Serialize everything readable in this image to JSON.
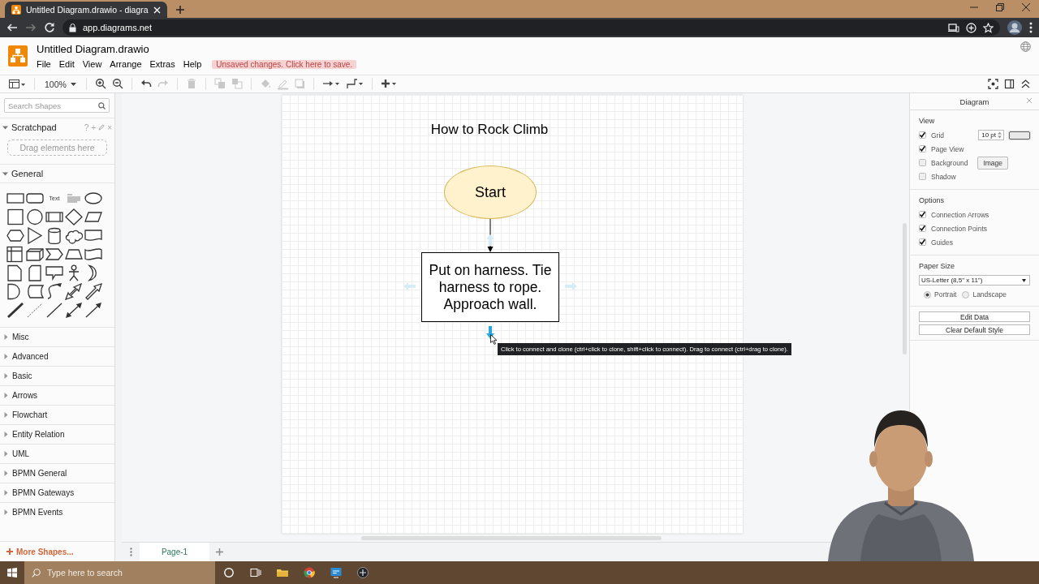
{
  "browser": {
    "tab_title": "Untitled Diagram.drawio - diagra",
    "url": "app.diagrams.net",
    "nav": [
      {
        "kind": "back",
        "disabled": false
      },
      {
        "kind": "forward",
        "disabled": true
      },
      {
        "kind": "reload",
        "disabled": false
      }
    ]
  },
  "app": {
    "file_name": "Untitled Diagram.drawio",
    "menus": [
      "File",
      "Edit",
      "View",
      "Arrange",
      "Extras",
      "Help"
    ],
    "save_notice": "Unsaved changes. Click here to save."
  },
  "toolbar": {
    "zoom": "100%",
    "tools": [
      {
        "kind": "panel",
        "disabled": false
      },
      {
        "kind": "zoomin",
        "disabled": false
      },
      {
        "kind": "zoomout",
        "disabled": false
      },
      {
        "kind": "undo",
        "disabled": false
      },
      {
        "kind": "redo",
        "disabled": true
      },
      {
        "kind": "delete",
        "disabled": true
      },
      {
        "kind": "tofront",
        "disabled": true
      },
      {
        "kind": "toback",
        "disabled": true
      },
      {
        "kind": "fill",
        "disabled": true
      },
      {
        "kind": "linecolor",
        "disabled": true
      },
      {
        "kind": "shadow",
        "disabled": true
      },
      {
        "kind": "connection",
        "disabled": false
      },
      {
        "kind": "waypoints",
        "disabled": false
      },
      {
        "kind": "insert",
        "disabled": false
      }
    ],
    "right_tools": [
      {
        "kind": "fullscreen"
      },
      {
        "kind": "format"
      },
      {
        "kind": "collapse"
      }
    ]
  },
  "sidebar": {
    "search": {
      "placeholder": "Search Shapes"
    },
    "scratchpad": {
      "title": "Scratchpad",
      "expanded": true,
      "actions": [
        "?",
        "+",
        "×"
      ],
      "drop_hint": "Drag elements here"
    },
    "general": {
      "title": "General",
      "expanded": true,
      "shapes": [
        {
          "kind": "rectangle"
        },
        {
          "kind": "rounded"
        },
        {
          "kind": "text",
          "label": "Text"
        },
        {
          "kind": "textbox"
        },
        {
          "kind": "ellipse"
        },
        {
          "kind": "square"
        },
        {
          "kind": "circle"
        },
        {
          "kind": "process"
        },
        {
          "kind": "diamond"
        },
        {
          "kind": "parallelogram"
        },
        {
          "kind": "hexagon"
        },
        {
          "kind": "triangle"
        },
        {
          "kind": "cylinder"
        },
        {
          "kind": "cloud"
        },
        {
          "kind": "document"
        },
        {
          "kind": "storage"
        },
        {
          "kind": "cube"
        },
        {
          "kind": "step"
        },
        {
          "kind": "trapezoid"
        },
        {
          "kind": "tape"
        },
        {
          "kind": "note"
        },
        {
          "kind": "card"
        },
        {
          "kind": "callout"
        },
        {
          "kind": "actor"
        },
        {
          "kind": "or"
        },
        {
          "kind": "and"
        },
        {
          "kind": "datastore"
        },
        {
          "kind": "curve"
        },
        {
          "kind": "doublearrow"
        },
        {
          "kind": "arrow"
        },
        {
          "kind": "thickline"
        },
        {
          "kind": "dashedline"
        },
        {
          "kind": "line"
        },
        {
          "kind": "biconnector"
        },
        {
          "kind": "connector"
        }
      ]
    },
    "sections": [
      {
        "title": "Misc",
        "expanded": false
      },
      {
        "title": "Advanced",
        "expanded": false
      },
      {
        "title": "Basic",
        "expanded": false
      },
      {
        "title": "Arrows",
        "expanded": false
      },
      {
        "title": "Flowchart",
        "expanded": false
      },
      {
        "title": "Entity Relation",
        "expanded": false
      },
      {
        "title": "UML",
        "expanded": false
      },
      {
        "title": "BPMN General",
        "expanded": false
      },
      {
        "title": "BPMN Gateways",
        "expanded": false
      },
      {
        "title": "BPMN Events",
        "expanded": false
      }
    ],
    "more_shapes": "More Shapes..."
  },
  "canvas": {
    "title": "How to Rock Climb",
    "nodes": [
      {
        "kind": "ellipse",
        "label": "Start"
      },
      {
        "kind": "process",
        "label": "Put on harness. Tie harness to rope. Approach wall."
      }
    ],
    "connect_arrows": [
      {
        "kind": "top",
        "highlighted": false
      },
      {
        "kind": "left",
        "highlighted": false
      },
      {
        "kind": "right",
        "highlighted": false
      },
      {
        "kind": "bottom",
        "highlighted": true
      }
    ],
    "tooltip": "Click to connect and clone (ctrl+click to clone, shift+click to connect). Drag to connect (ctrl+drag to clone)."
  },
  "pages": [
    {
      "label": "Page-1",
      "selected": true
    }
  ],
  "format_panel": {
    "title": "Diagram",
    "view": {
      "heading": "View",
      "options": [
        {
          "label": "Grid",
          "checked": true,
          "value": "10 pt"
        },
        {
          "label": "Page View",
          "checked": true
        },
        {
          "label": "Background",
          "checked": false,
          "button": "Image"
        },
        {
          "label": "Shadow",
          "checked": false
        }
      ]
    },
    "options": {
      "heading": "Options",
      "items": [
        {
          "label": "Connection Arrows",
          "checked": true
        },
        {
          "label": "Connection Points",
          "checked": true
        },
        {
          "label": "Guides",
          "checked": true
        }
      ]
    },
    "paper": {
      "heading": "Paper Size",
      "size": "US-Letter (8,5\" x 11\")",
      "orientations": [
        {
          "label": "Portrait",
          "selected": true
        },
        {
          "label": "Landscape",
          "selected": false
        }
      ]
    },
    "buttons": [
      "Edit Data",
      "Clear Default Style"
    ]
  },
  "taskbar": {
    "search_placeholder": "Type here to search"
  }
}
